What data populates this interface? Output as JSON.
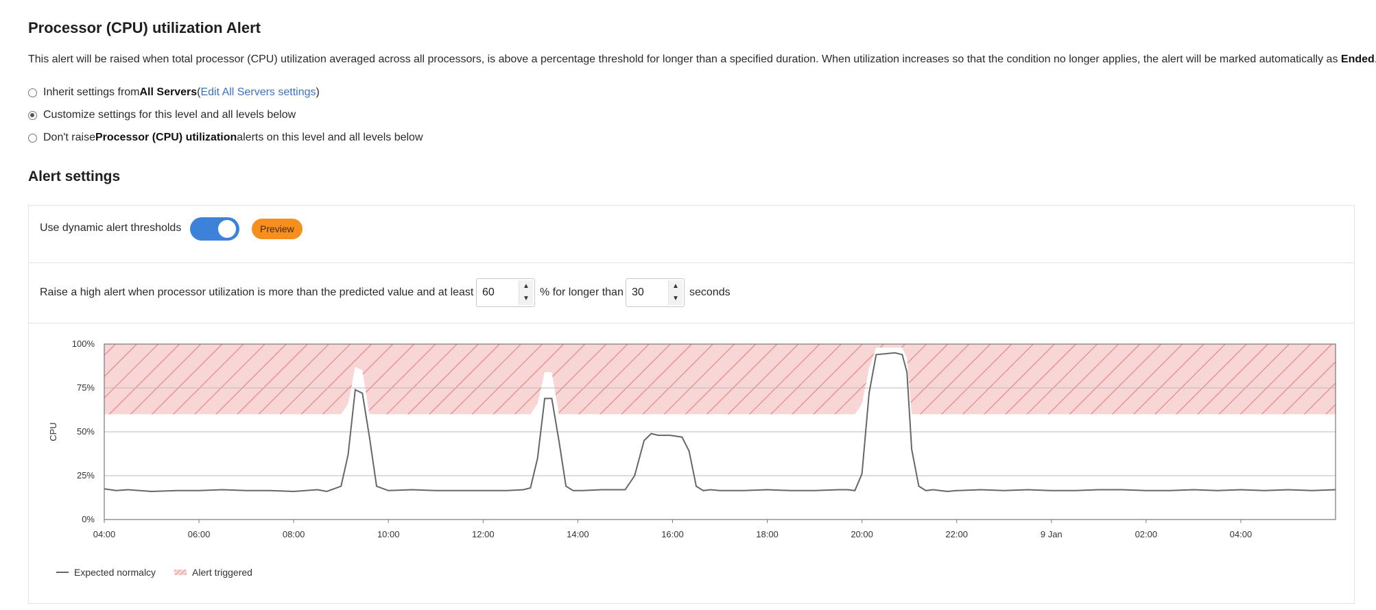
{
  "page": {
    "title": "Processor (CPU) utilization Alert",
    "description_pre": "This alert will be raised when total processor (CPU) utilization averaged across all processors, is above a percentage threshold for longer than a specified duration. When utilization increases so that the condition no longer applies, the alert will be marked automatically as ",
    "description_bold": "Ended",
    "description_post": "."
  },
  "options": {
    "inherit": {
      "pre": "Inherit settings from ",
      "bold": "All Servers",
      "paren_open": " (",
      "link": "Edit All Servers settings",
      "paren_close": ")",
      "checked": false
    },
    "customize": {
      "label": "Customize settings for this level and all levels below",
      "checked": true
    },
    "dont_raise": {
      "pre": "Don't raise ",
      "bold": "Processor (CPU) utilization",
      "post": " alerts on this level and all levels below",
      "checked": false
    }
  },
  "alert_settings": {
    "title": "Alert settings",
    "dynamic_label": "Use dynamic alert thresholds",
    "dynamic_enabled": true,
    "preview_label": "Preview",
    "rule_text_1": "Raise a high alert when processor utilization is more than the predicted value and at least",
    "percent_value": "60",
    "rule_text_2": "% for longer than",
    "duration_value": "30",
    "rule_text_3": "seconds"
  },
  "colors": {
    "line": "#666666",
    "alert_fill": "#f9d6d6",
    "alert_hatch": "#e57c7c",
    "toggle": "#3b82d8",
    "preview": "#f68f1e",
    "link": "#3a72c0"
  },
  "chart_data": {
    "type": "line",
    "ylabel": "CPU",
    "ylim": [
      0,
      100
    ],
    "y_ticks": [
      "0%",
      "25%",
      "50%",
      "75%",
      "100%"
    ],
    "x_ticks": [
      "04:00",
      "06:00",
      "08:00",
      "10:00",
      "12:00",
      "14:00",
      "16:00",
      "18:00",
      "20:00",
      "22:00",
      "9 Jan",
      "02:00",
      "04:00"
    ],
    "x_hours_start": 4,
    "x_hours_end": 30,
    "grid": true,
    "legend": [
      "Expected normalcy",
      "Alert triggered"
    ],
    "legend_position": "bottom-left",
    "series": [
      {
        "name": "Expected normalcy",
        "x": [
          4.0,
          4.25,
          4.5,
          5.0,
          5.5,
          6.0,
          6.5,
          7.0,
          7.5,
          8.0,
          8.5,
          8.7,
          8.85,
          9.0,
          9.15,
          9.3,
          9.45,
          9.6,
          9.75,
          10.0,
          10.5,
          11.0,
          11.5,
          12.0,
          12.5,
          12.85,
          13.0,
          13.15,
          13.3,
          13.45,
          13.6,
          13.75,
          13.9,
          14.1,
          14.5,
          15.0,
          15.2,
          15.4,
          15.55,
          15.7,
          15.8,
          15.95,
          16.2,
          16.35,
          16.5,
          16.65,
          16.8,
          17.0,
          17.5,
          18.0,
          18.5,
          19.0,
          19.5,
          19.7,
          19.85,
          20.0,
          20.15,
          20.3,
          20.7,
          20.85,
          20.95,
          21.05,
          21.2,
          21.35,
          21.5,
          21.8,
          22.0,
          22.5,
          23.0,
          23.5,
          24.0,
          24.5,
          25.0,
          25.5,
          26.0,
          26.5,
          27.0,
          27.5,
          28.0,
          28.5,
          29.0,
          29.5,
          30.0
        ],
        "values": [
          17.5,
          16.5,
          17,
          16,
          16.5,
          16.5,
          17,
          16.5,
          16.5,
          16,
          17,
          16,
          17.5,
          19,
          37,
          74,
          72,
          47,
          19,
          16.5,
          17,
          16.5,
          16.5,
          16.5,
          16.5,
          17,
          18,
          35,
          69,
          69,
          45,
          19,
          16.5,
          16.5,
          17,
          17,
          25,
          45,
          49,
          48,
          48,
          48,
          47,
          39,
          19,
          16.5,
          17,
          16.5,
          16.5,
          17,
          16.5,
          16.5,
          17,
          17,
          16.5,
          26,
          72,
          94,
          95,
          94,
          84,
          40,
          19,
          16.5,
          17,
          16,
          16.5,
          17,
          16.5,
          17,
          16.5,
          16.5,
          17,
          17,
          16.5,
          16.5,
          17,
          16.5,
          17,
          16.5,
          17,
          16.5,
          17
        ]
      },
      {
        "name": "Alert triggered",
        "x": [
          4.0,
          9.0,
          9.15,
          9.3,
          9.45,
          9.6,
          9.75,
          13.0,
          13.15,
          13.3,
          13.45,
          13.6,
          13.75,
          19.85,
          20.0,
          20.15,
          20.3,
          20.7,
          20.85,
          20.95,
          21.05,
          21.2,
          21.35,
          30.0
        ],
        "values": [
          60,
          60,
          66,
          87,
          85,
          60,
          60,
          60,
          66,
          84,
          84,
          60,
          60,
          60,
          66,
          86,
          98,
          98,
          98,
          92,
          60,
          60,
          60,
          60
        ]
      }
    ]
  }
}
